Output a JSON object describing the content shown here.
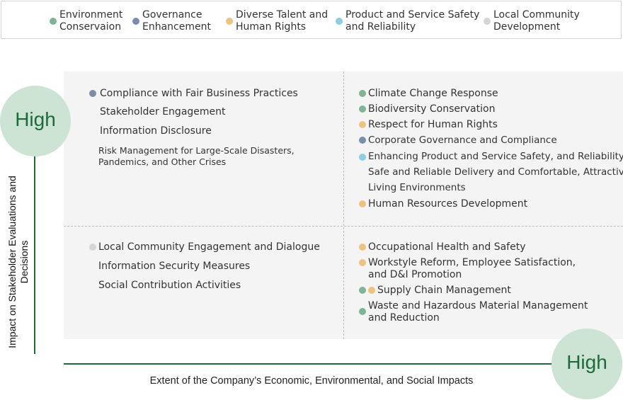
{
  "colors": {
    "environment": "#7fb596",
    "governance": "#7a8eac",
    "talent": "#edc37f",
    "safety": "#8ccfe0",
    "community": "#d6d6d6",
    "axis": "#1d6b3a",
    "circle": "#cde3d4",
    "quadrant_bg": "#f4f4f4"
  },
  "legend": [
    {
      "key": "environment",
      "label": "Environment\nConservaion"
    },
    {
      "key": "governance",
      "label": "Governance\nEnhancement"
    },
    {
      "key": "talent",
      "label": "Diverse Talent and\nHuman Rights"
    },
    {
      "key": "safety",
      "label": "Product and Service Safety\nand Reliability"
    },
    {
      "key": "community",
      "label": "Local Community\nDevelopment"
    }
  ],
  "axes": {
    "y_label": "Impact on Stakeholder Evaluations and Decisions",
    "x_label": "Extent of the Company’s Economic, Environmental, and Social Impacts",
    "y_high": "High",
    "x_high": "High"
  },
  "quadrants": {
    "top_left": [
      {
        "text": "Compliance with Fair Business Practices",
        "categories": [
          "governance"
        ]
      },
      {
        "text": "Stakeholder Engagement",
        "categories": []
      },
      {
        "text": "Information Disclosure",
        "categories": []
      },
      {
        "text": "Risk Management for Large-Scale Disasters,\nPandemics, and Other Crises",
        "categories": []
      }
    ],
    "top_right": [
      {
        "text": "Climate Change Response",
        "categories": [
          "environment"
        ]
      },
      {
        "text": "Biodiversity Conservation",
        "categories": [
          "environment"
        ]
      },
      {
        "text": "Respect for Human Rights",
        "categories": [
          "talent"
        ]
      },
      {
        "text": "Corporate Governance and Compliance",
        "categories": [
          "governance"
        ]
      },
      {
        "text": "Enhancing Product and Service Safety, and Reliability\nSafe and Reliable Delivery and Comfortable, Attractive\nLiving Environments",
        "categories": [
          "safety"
        ]
      },
      {
        "text": "Human Resources Development",
        "categories": [
          "talent"
        ]
      }
    ],
    "bottom_left": [
      {
        "text": "Local Community Engagement and Dialogue",
        "categories": [
          "community"
        ]
      },
      {
        "text": "Information Security Measures",
        "categories": []
      },
      {
        "text": "Social Contribution Activities",
        "categories": []
      }
    ],
    "bottom_right": [
      {
        "text": "Occupational Health and Safety",
        "categories": [
          "talent"
        ]
      },
      {
        "text": "Workstyle Reform, Employee Satisfaction,\nand D&I Promotion",
        "categories": [
          "talent"
        ]
      },
      {
        "text": "Supply Chain Management",
        "categories": [
          "environment",
          "talent"
        ]
      },
      {
        "text": "Waste and Hazardous Material Management\nand Reduction",
        "categories": [
          "environment"
        ]
      }
    ]
  }
}
